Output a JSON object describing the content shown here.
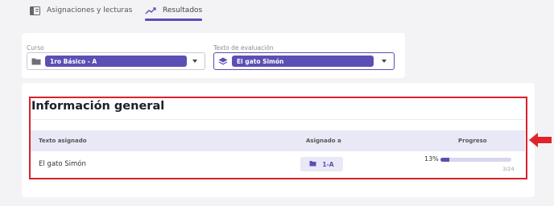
{
  "tabs": [
    {
      "label": "Asignaciones y lecturas",
      "icon": "calendar-icon",
      "active": false
    },
    {
      "label": "Resultados",
      "icon": "trending-up-icon",
      "active": true
    }
  ],
  "filters": {
    "curso": {
      "label": "Curso",
      "value": "1ro Básico - A",
      "icon": "folder-icon"
    },
    "texto": {
      "label": "Texto de evaluación",
      "value": "El gato Simón",
      "icon": "layers-icon"
    }
  },
  "overview": {
    "title": "Información general",
    "columns": [
      "Texto asignado",
      "Asignado a",
      "Progreso"
    ],
    "rows": [
      {
        "text": "El gato Simón",
        "assigned": "1-A",
        "progress_label": "13%",
        "progress_fraction": 0.13,
        "count": "3/24"
      }
    ]
  },
  "colors": {
    "accent": "#5b4fb5",
    "highlight": "#d9222a",
    "header_bg": "#e9e8f6"
  }
}
